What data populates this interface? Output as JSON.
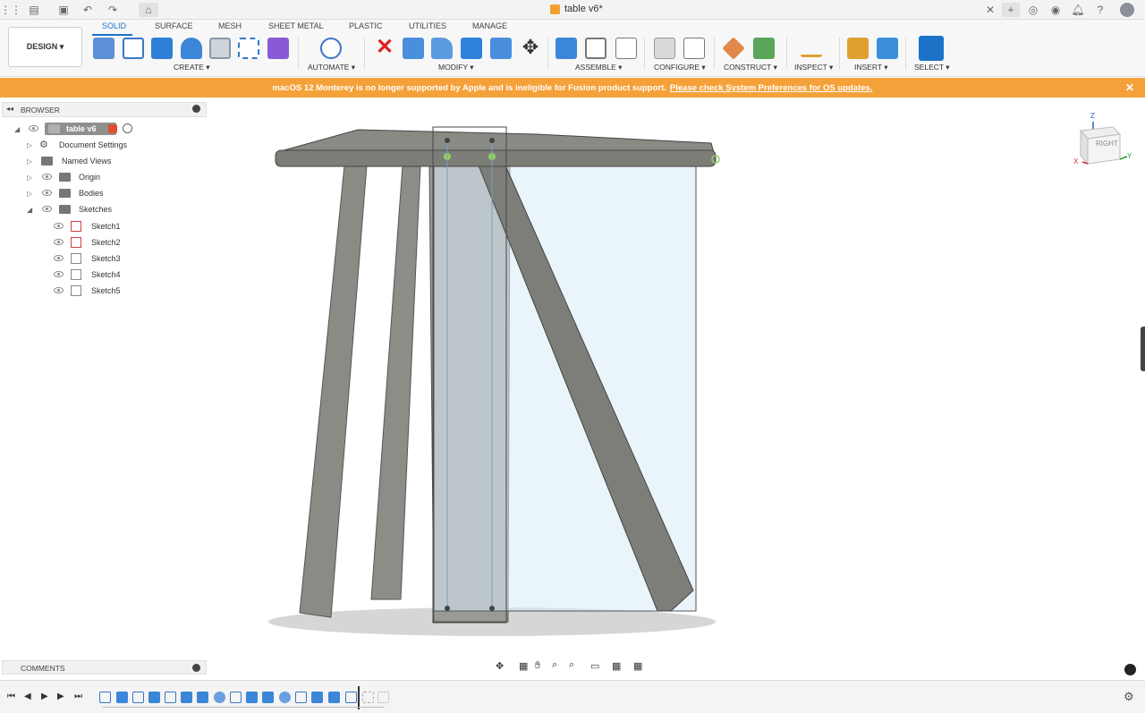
{
  "window": {
    "title": "table v6*"
  },
  "toolbar": {
    "workspace": "DESIGN ▾",
    "tabs": [
      {
        "label": "SOLID",
        "active": true
      },
      {
        "label": "SURFACE"
      },
      {
        "label": "MESH"
      },
      {
        "label": "SHEET METAL"
      },
      {
        "label": "PLASTIC"
      },
      {
        "label": "UTILITIES"
      },
      {
        "label": "MANAGE"
      }
    ],
    "groups": {
      "create": "CREATE ▾",
      "automate": "AUTOMATE ▾",
      "modify": "MODIFY ▾",
      "assemble": "ASSEMBLE ▾",
      "configure": "CONFIGURE ▾",
      "construct": "CONSTRUCT ▾",
      "inspect": "INSPECT ▾",
      "insert": "INSERT ▾",
      "select": "SELECT ▾"
    }
  },
  "banner": {
    "message": "macOS 12 Monterey is no longer supported by Apple and is ineligible for Fusion product support.",
    "link": "Please check System Preferences for OS updates."
  },
  "browser": {
    "title": "BROWSER",
    "root": "table v6",
    "items": [
      {
        "label": "Document Settings"
      },
      {
        "label": "Named Views"
      },
      {
        "label": "Origin"
      },
      {
        "label": "Bodies"
      },
      {
        "label": "Sketches"
      }
    ],
    "sketches": [
      "Sketch1",
      "Sketch2",
      "Sketch3",
      "Sketch4",
      "Sketch5"
    ]
  },
  "comments": {
    "title": "COMMENTS"
  },
  "viewcube": {
    "face": "RIGHT",
    "axis_x": "X",
    "axis_y": "Y",
    "axis_z": "Z"
  },
  "colors": {
    "accent": "#1a73c8",
    "banner": "#f5a13a",
    "model": "#7a7a76"
  }
}
